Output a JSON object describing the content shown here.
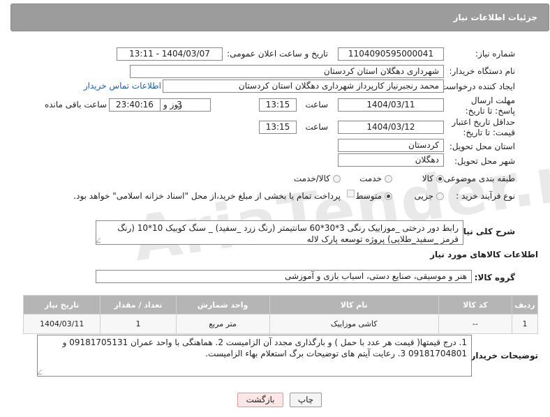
{
  "header": {
    "title": "جزئیات اطلاعات نیاز"
  },
  "watermark": "AriaTender.neT",
  "need_number": {
    "label": "شماره نیاز:",
    "value": "1104090595000041"
  },
  "announce": {
    "label": "تاریخ و ساعت اعلان عمومی:",
    "value": "1404/03/07 - 13:11"
  },
  "buyer_org": {
    "label": "نام دستگاه خریدار:",
    "value": "شهرداری دهگلان استان کردستان"
  },
  "creator": {
    "label": "ایجاد کننده درخواست:",
    "value": "محمد رنجبرنیاز کارپرداز شهرداری دهگلان استان کردستان",
    "contact_link": "اطلاعات تماس خریدار"
  },
  "deadline": {
    "label": "مهلت ارسال پاسخ: تا تاریخ:",
    "date": "1404/03/11",
    "time_label": "ساعت",
    "time": "13:15",
    "days": "3",
    "days_label": "روز و",
    "remaining": "23:40:16",
    "remaining_label": "ساعت باقی مانده"
  },
  "validity": {
    "label": "حداقل تاریخ اعتبار قیمت: تا تاریخ:",
    "date": "1404/03/12",
    "time_label": "ساعت",
    "time": "13:15"
  },
  "province": {
    "label": "استان محل تحویل:",
    "value": "کردستان"
  },
  "city": {
    "label": "شهر محل تحویل:",
    "value": "دهگلان"
  },
  "category": {
    "label": "طبقه بندی موضوعی:",
    "options": [
      "کالا",
      "خدمت",
      "کالا/خدمت"
    ],
    "selected": "کالا"
  },
  "purchase_type": {
    "label": "نوع فرآیند خرید :",
    "options": [
      "جزیی",
      "متوسط"
    ],
    "selected": "متوسط",
    "payment_note": "پرداخت تمام یا بخشی از مبلغ خرید،از محل \"اسناد خزانه اسلامی\" خواهد بود."
  },
  "description": {
    "label": "شرح کلی نیاز:",
    "value": "رابط دور درختی _موزاییک رنگی 3*30*60 سانتیمتر (رنگ زرد _سفید) _ سنگ کوبیک 10*10 (رنگ قرمز _سفید_طلایی) پروژه توسعه پارک لاله"
  },
  "goods_info": {
    "title": "اطلاعات کالاهای مورد نیاز"
  },
  "goods_group": {
    "label": "گروه کالا:",
    "value": "هنر و موسیقی، صنایع دستی، اسباب بازی و آموزشی"
  },
  "table": {
    "headers": [
      "ردیف",
      "کد کالا",
      "نام کالا",
      "واحد شمارش",
      "تعداد / مقدار",
      "تاریخ نیاز"
    ],
    "rows": [
      {
        "row": "1",
        "code": "--",
        "name": "کاشی موزاییک",
        "unit": "متر مربع",
        "qty": "1",
        "date": "1404/03/11"
      }
    ]
  },
  "buyer_notes": {
    "label": "توضیحات خریدار:",
    "value": "1. درج قیمتها( قیمت هر عدد با حمل  ) و بارگذاری مجدد آن الزامیست 2. هماهنگی با واحد عمران 09181705131 و 09181704801  3. رعایت آیتم های توضیحات برگ استعلام بهاء الزامیست."
  },
  "buttons": {
    "print": "چاپ",
    "back": "بازگشت"
  }
}
